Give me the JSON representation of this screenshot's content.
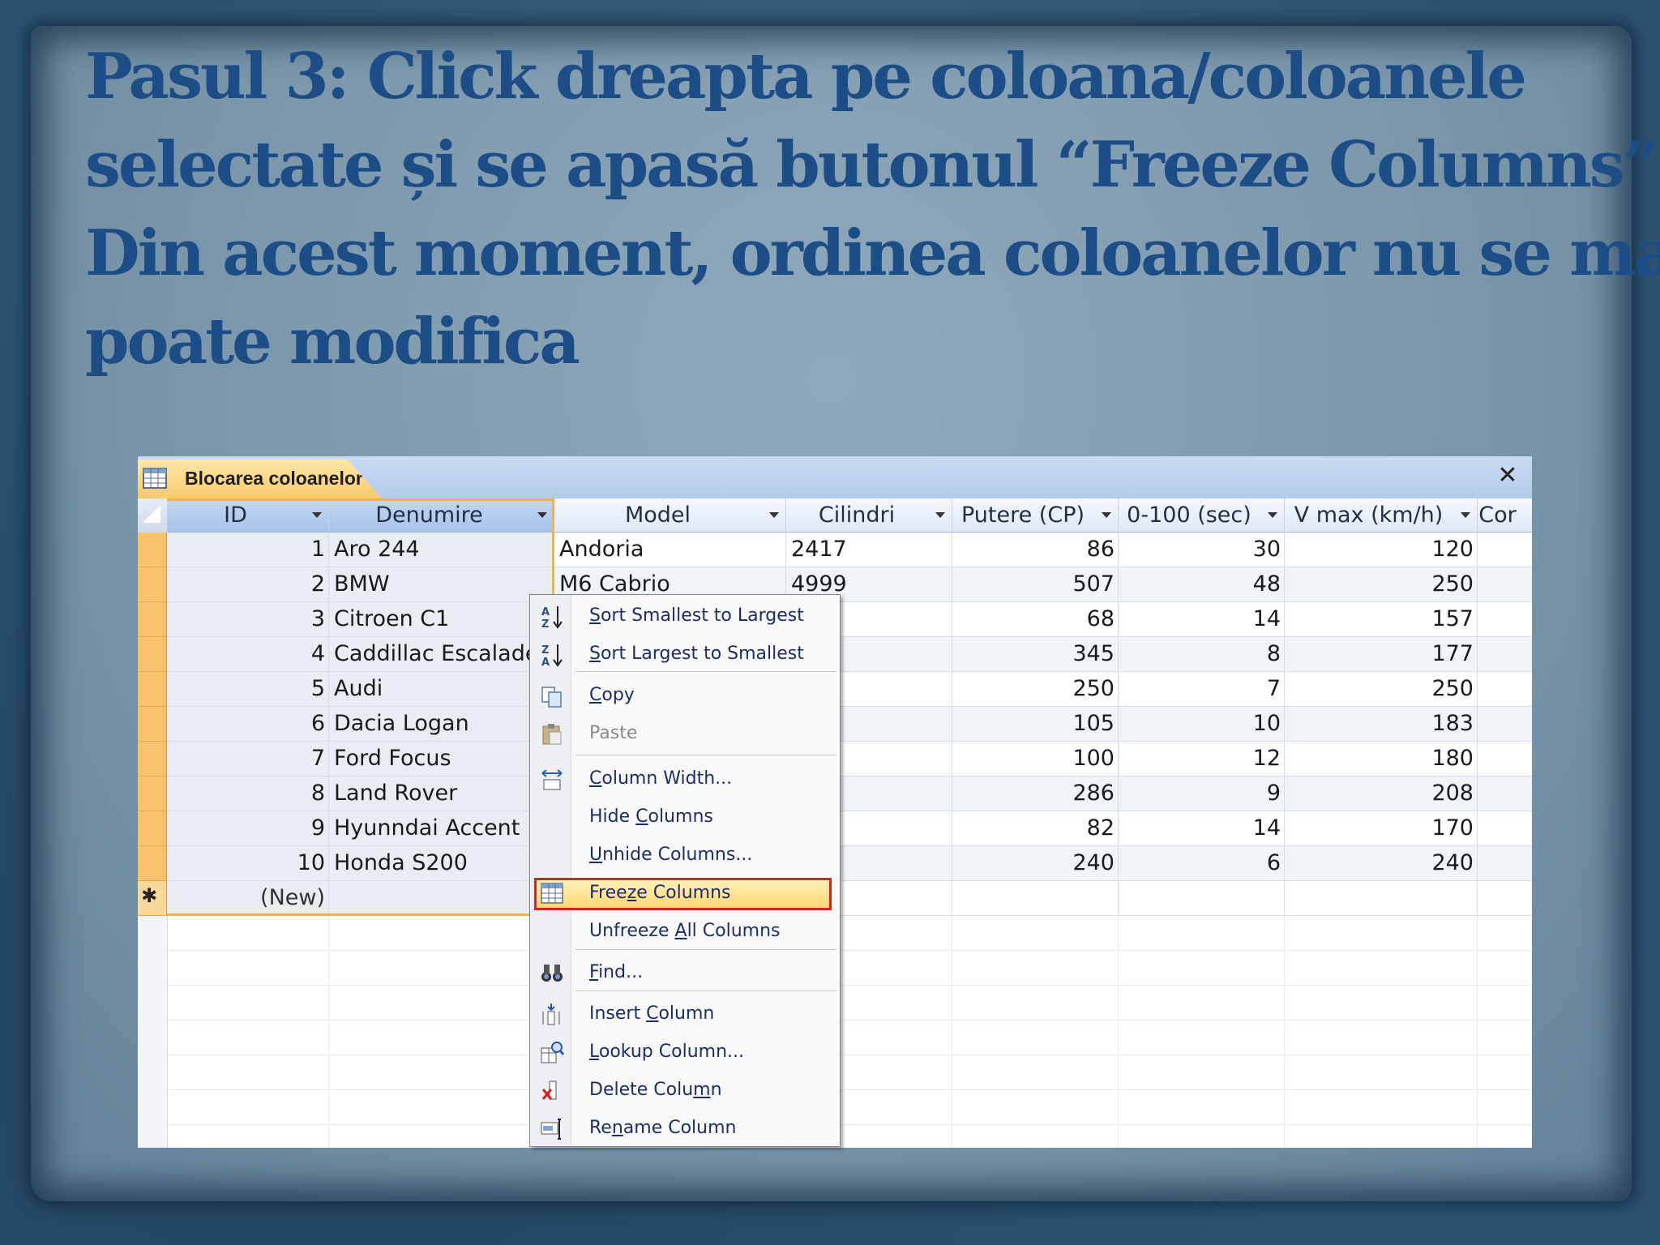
{
  "slide": {
    "title_lines": [
      "Pasul 3: Click dreapta pe coloana/coloanele",
      "selectate și se apasă butonul “Freeze  Columns”",
      "Din acest moment, ordinea coloanelor nu se mai",
      "poate modifica"
    ]
  },
  "window": {
    "tab_label": "Blocarea coloanelor",
    "close_label": "✕"
  },
  "columns": [
    "ID",
    "Denumire",
    "Model",
    "Cilindri",
    "Putere (CP)",
    "0-100 (sec)",
    "V max (km/h)",
    "Cor"
  ],
  "rows": [
    {
      "id": "1",
      "denumire": "Aro 244",
      "model": "Andoria",
      "cilindri": "2417",
      "putere": "86",
      "acc": "30",
      "vmax": "120"
    },
    {
      "id": "2",
      "denumire": "BMW",
      "model": "M6 Cabrio",
      "cilindri": "4999",
      "putere": "507",
      "acc": "48",
      "vmax": "250"
    },
    {
      "id": "3",
      "denumire": "Citroen C1",
      "model": "",
      "cilindri": "",
      "putere": "68",
      "acc": "14",
      "vmax": "157"
    },
    {
      "id": "4",
      "denumire": "Caddillac Escalade",
      "model": "",
      "cilindri": "",
      "putere": "345",
      "acc": "8",
      "vmax": "177"
    },
    {
      "id": "5",
      "denumire": "Audi",
      "model": "",
      "cilindri": "",
      "putere": "250",
      "acc": "7",
      "vmax": "250"
    },
    {
      "id": "6",
      "denumire": "Dacia Logan",
      "model": "",
      "cilindri": "",
      "putere": "105",
      "acc": "10",
      "vmax": "183"
    },
    {
      "id": "7",
      "denumire": "Ford Focus",
      "model": "",
      "cilindri": "",
      "putere": "100",
      "acc": "12",
      "vmax": "180"
    },
    {
      "id": "8",
      "denumire": "Land Rover",
      "model": "",
      "cilindri": "",
      "putere": "286",
      "acc": "9",
      "vmax": "208"
    },
    {
      "id": "9",
      "denumire": "Hyunndai Accent",
      "model": "",
      "cilindri": "",
      "putere": "82",
      "acc": "14",
      "vmax": "170"
    },
    {
      "id": "10",
      "denumire": "Honda S200",
      "model": "",
      "cilindri": "",
      "putere": "240",
      "acc": "6",
      "vmax": "240"
    }
  ],
  "new_row": {
    "marker": "✱",
    "id": "(New)"
  },
  "context_menu": {
    "items": [
      {
        "label": "Sort Smallest to Largest",
        "icon": "sort-az-icon",
        "enabled": true
      },
      {
        "label": "Sort Largest to Smallest",
        "icon": "sort-za-icon",
        "enabled": true
      },
      {
        "label": "Copy",
        "icon": "copy-icon",
        "enabled": true
      },
      {
        "label": "Paste",
        "icon": "paste-icon",
        "enabled": false
      },
      {
        "label": "Column Width...",
        "icon": "column-width-icon",
        "enabled": true
      },
      {
        "label": "Hide Columns",
        "icon": "",
        "enabled": true
      },
      {
        "label": "Unhide Columns...",
        "icon": "",
        "enabled": true
      },
      {
        "label": "Freeze Columns",
        "icon": "freeze-grid-icon",
        "enabled": true,
        "highlighted": true
      },
      {
        "label": "Unfreeze All Columns",
        "icon": "",
        "enabled": true
      },
      {
        "label": "Find...",
        "icon": "binoculars-icon",
        "enabled": true
      },
      {
        "label": "Insert Column",
        "icon": "insert-column-icon",
        "enabled": true
      },
      {
        "label": "Lookup Column...",
        "icon": "lookup-column-icon",
        "enabled": true
      },
      {
        "label": "Delete Column",
        "icon": "delete-column-icon",
        "enabled": true
      },
      {
        "label": "Rename Column",
        "icon": "rename-column-icon",
        "enabled": true
      }
    ]
  },
  "colors": {
    "title": "#1d4d86",
    "selection": "#f4b24a",
    "highlight_border": "#e02020"
  }
}
